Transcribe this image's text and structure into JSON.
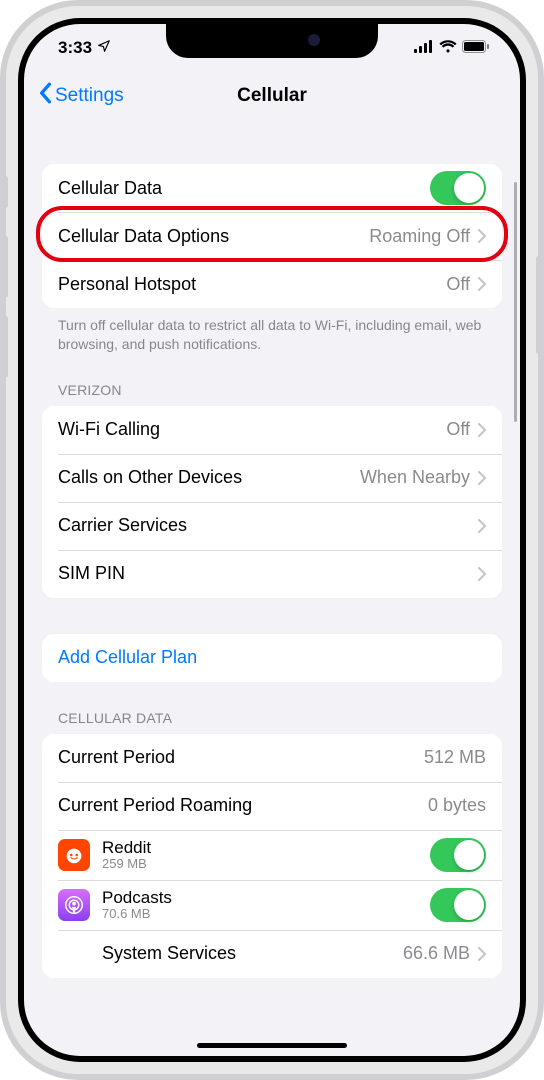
{
  "status": {
    "time": "3:33"
  },
  "nav": {
    "back": "Settings",
    "title": "Cellular"
  },
  "section1": {
    "cellular_data": "Cellular Data",
    "data_options": "Cellular Data Options",
    "data_options_value": "Roaming Off",
    "hotspot": "Personal Hotspot",
    "hotspot_value": "Off",
    "footer": "Turn off cellular data to restrict all data to Wi-Fi, including email, web browsing, and push notifications."
  },
  "section2": {
    "header": "VERIZON",
    "wifi_calling": "Wi-Fi Calling",
    "wifi_calling_value": "Off",
    "calls_other": "Calls on Other Devices",
    "calls_other_value": "When Nearby",
    "carrier_services": "Carrier Services",
    "sim_pin": "SIM PIN"
  },
  "section3": {
    "add_plan": "Add Cellular Plan"
  },
  "section4": {
    "header": "CELLULAR DATA",
    "current_period": "Current Period",
    "current_period_value": "512 MB",
    "roaming": "Current Period Roaming",
    "roaming_value": "0 bytes",
    "apps": [
      {
        "name": "Reddit",
        "size": "259 MB"
      },
      {
        "name": "Podcasts",
        "size": "70.6 MB"
      }
    ],
    "system_services": "System Services",
    "system_services_value": "66.6 MB"
  }
}
